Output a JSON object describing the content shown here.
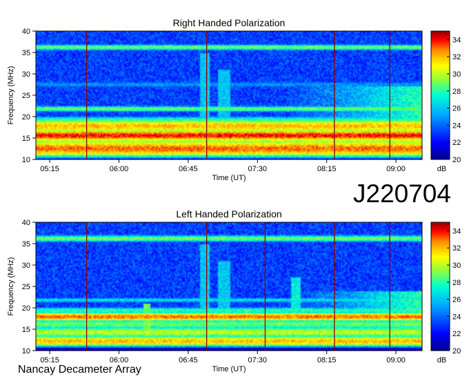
{
  "observation_id": "J220704",
  "footer": "Nancay Decameter Array",
  "chart_data": [
    {
      "type": "heatmap",
      "title": "Right Handed Polarization",
      "xlabel": "Time (UT)",
      "ylabel": "Frequency (MHz)",
      "x_ticks": [
        "05:15",
        "06:00",
        "06:45",
        "07:30",
        "08:15",
        "09:00"
      ],
      "x_tick_minutes": [
        315,
        360,
        405,
        450,
        495,
        540
      ],
      "xlim_minutes": [
        306,
        557
      ],
      "y_ticks": [
        10,
        15,
        20,
        25,
        30,
        35,
        40
      ],
      "ylim": [
        10,
        40
      ],
      "colorbar": {
        "label": "dB",
        "ticks": [
          20,
          22,
          24,
          26,
          28,
          30,
          32,
          34
        ],
        "range": [
          20,
          35
        ]
      },
      "features": {
        "bands": [
          {
            "f": 12.5,
            "w": 1.5,
            "level": 33
          },
          {
            "f": 14.3,
            "w": 1.0,
            "level": 30
          },
          {
            "f": 15.6,
            "w": 1.0,
            "level": 34
          },
          {
            "f": 17.8,
            "w": 1.3,
            "level": 32
          },
          {
            "f": 19.2,
            "w": 0.8,
            "level": 28
          },
          {
            "f": 21.8,
            "w": 0.6,
            "level": 29
          },
          {
            "f": 36.2,
            "w": 0.6,
            "level": 29
          },
          {
            "f": 27.5,
            "w": 0.8,
            "level": 25
          }
        ],
        "vertical_lines_minutes": [
          339,
          417,
          500,
          536
        ],
        "bursts": [
          {
            "t": 416,
            "w": 3,
            "f0": 15,
            "f1": 35,
            "level": 26
          },
          {
            "t": 428,
            "w": 4,
            "f0": 18,
            "f1": 31,
            "level": 26
          }
        ],
        "late_brightening": {
          "t0": 470,
          "t1": 557,
          "f0": 15,
          "f1": 27,
          "level": 28
        }
      }
    },
    {
      "type": "heatmap",
      "title": "Left Handed Polarization",
      "xlabel": "Time (UT)",
      "ylabel": "Frequency (MHz)",
      "x_ticks": [
        "05:15",
        "06:00",
        "06:45",
        "07:30",
        "08:15",
        "09:00"
      ],
      "x_tick_minutes": [
        315,
        360,
        405,
        450,
        495,
        540
      ],
      "xlim_minutes": [
        306,
        557
      ],
      "y_ticks": [
        10,
        15,
        20,
        25,
        30,
        35,
        40
      ],
      "ylim": [
        10,
        40
      ],
      "colorbar": {
        "label": "dB",
        "ticks": [
          20,
          22,
          24,
          26,
          28,
          30,
          32,
          34
        ],
        "range": [
          20,
          35
        ]
      },
      "features": {
        "bands": [
          {
            "f": 12.2,
            "w": 1.0,
            "level": 32
          },
          {
            "f": 14.3,
            "w": 1.2,
            "level": 30
          },
          {
            "f": 16.2,
            "w": 1.0,
            "level": 29
          },
          {
            "f": 17.9,
            "w": 0.8,
            "level": 33
          },
          {
            "f": 19.4,
            "w": 0.7,
            "level": 28
          },
          {
            "f": 21.8,
            "w": 0.5,
            "level": 27
          },
          {
            "f": 36.2,
            "w": 0.7,
            "level": 29
          }
        ],
        "vertical_lines_minutes": [
          339,
          417,
          455,
          500,
          536
        ],
        "bursts": [
          {
            "t": 416,
            "w": 3,
            "f0": 15,
            "f1": 35,
            "level": 26
          },
          {
            "t": 428,
            "w": 4,
            "f0": 18,
            "f1": 31,
            "level": 26
          },
          {
            "t": 475,
            "w": 3,
            "f0": 17,
            "f1": 27,
            "level": 27
          },
          {
            "t": 378,
            "w": 2,
            "f0": 14,
            "f1": 21,
            "level": 29
          }
        ],
        "late_brightening": {
          "t0": 475,
          "t1": 557,
          "f0": 15,
          "f1": 24,
          "level": 28
        }
      }
    }
  ]
}
